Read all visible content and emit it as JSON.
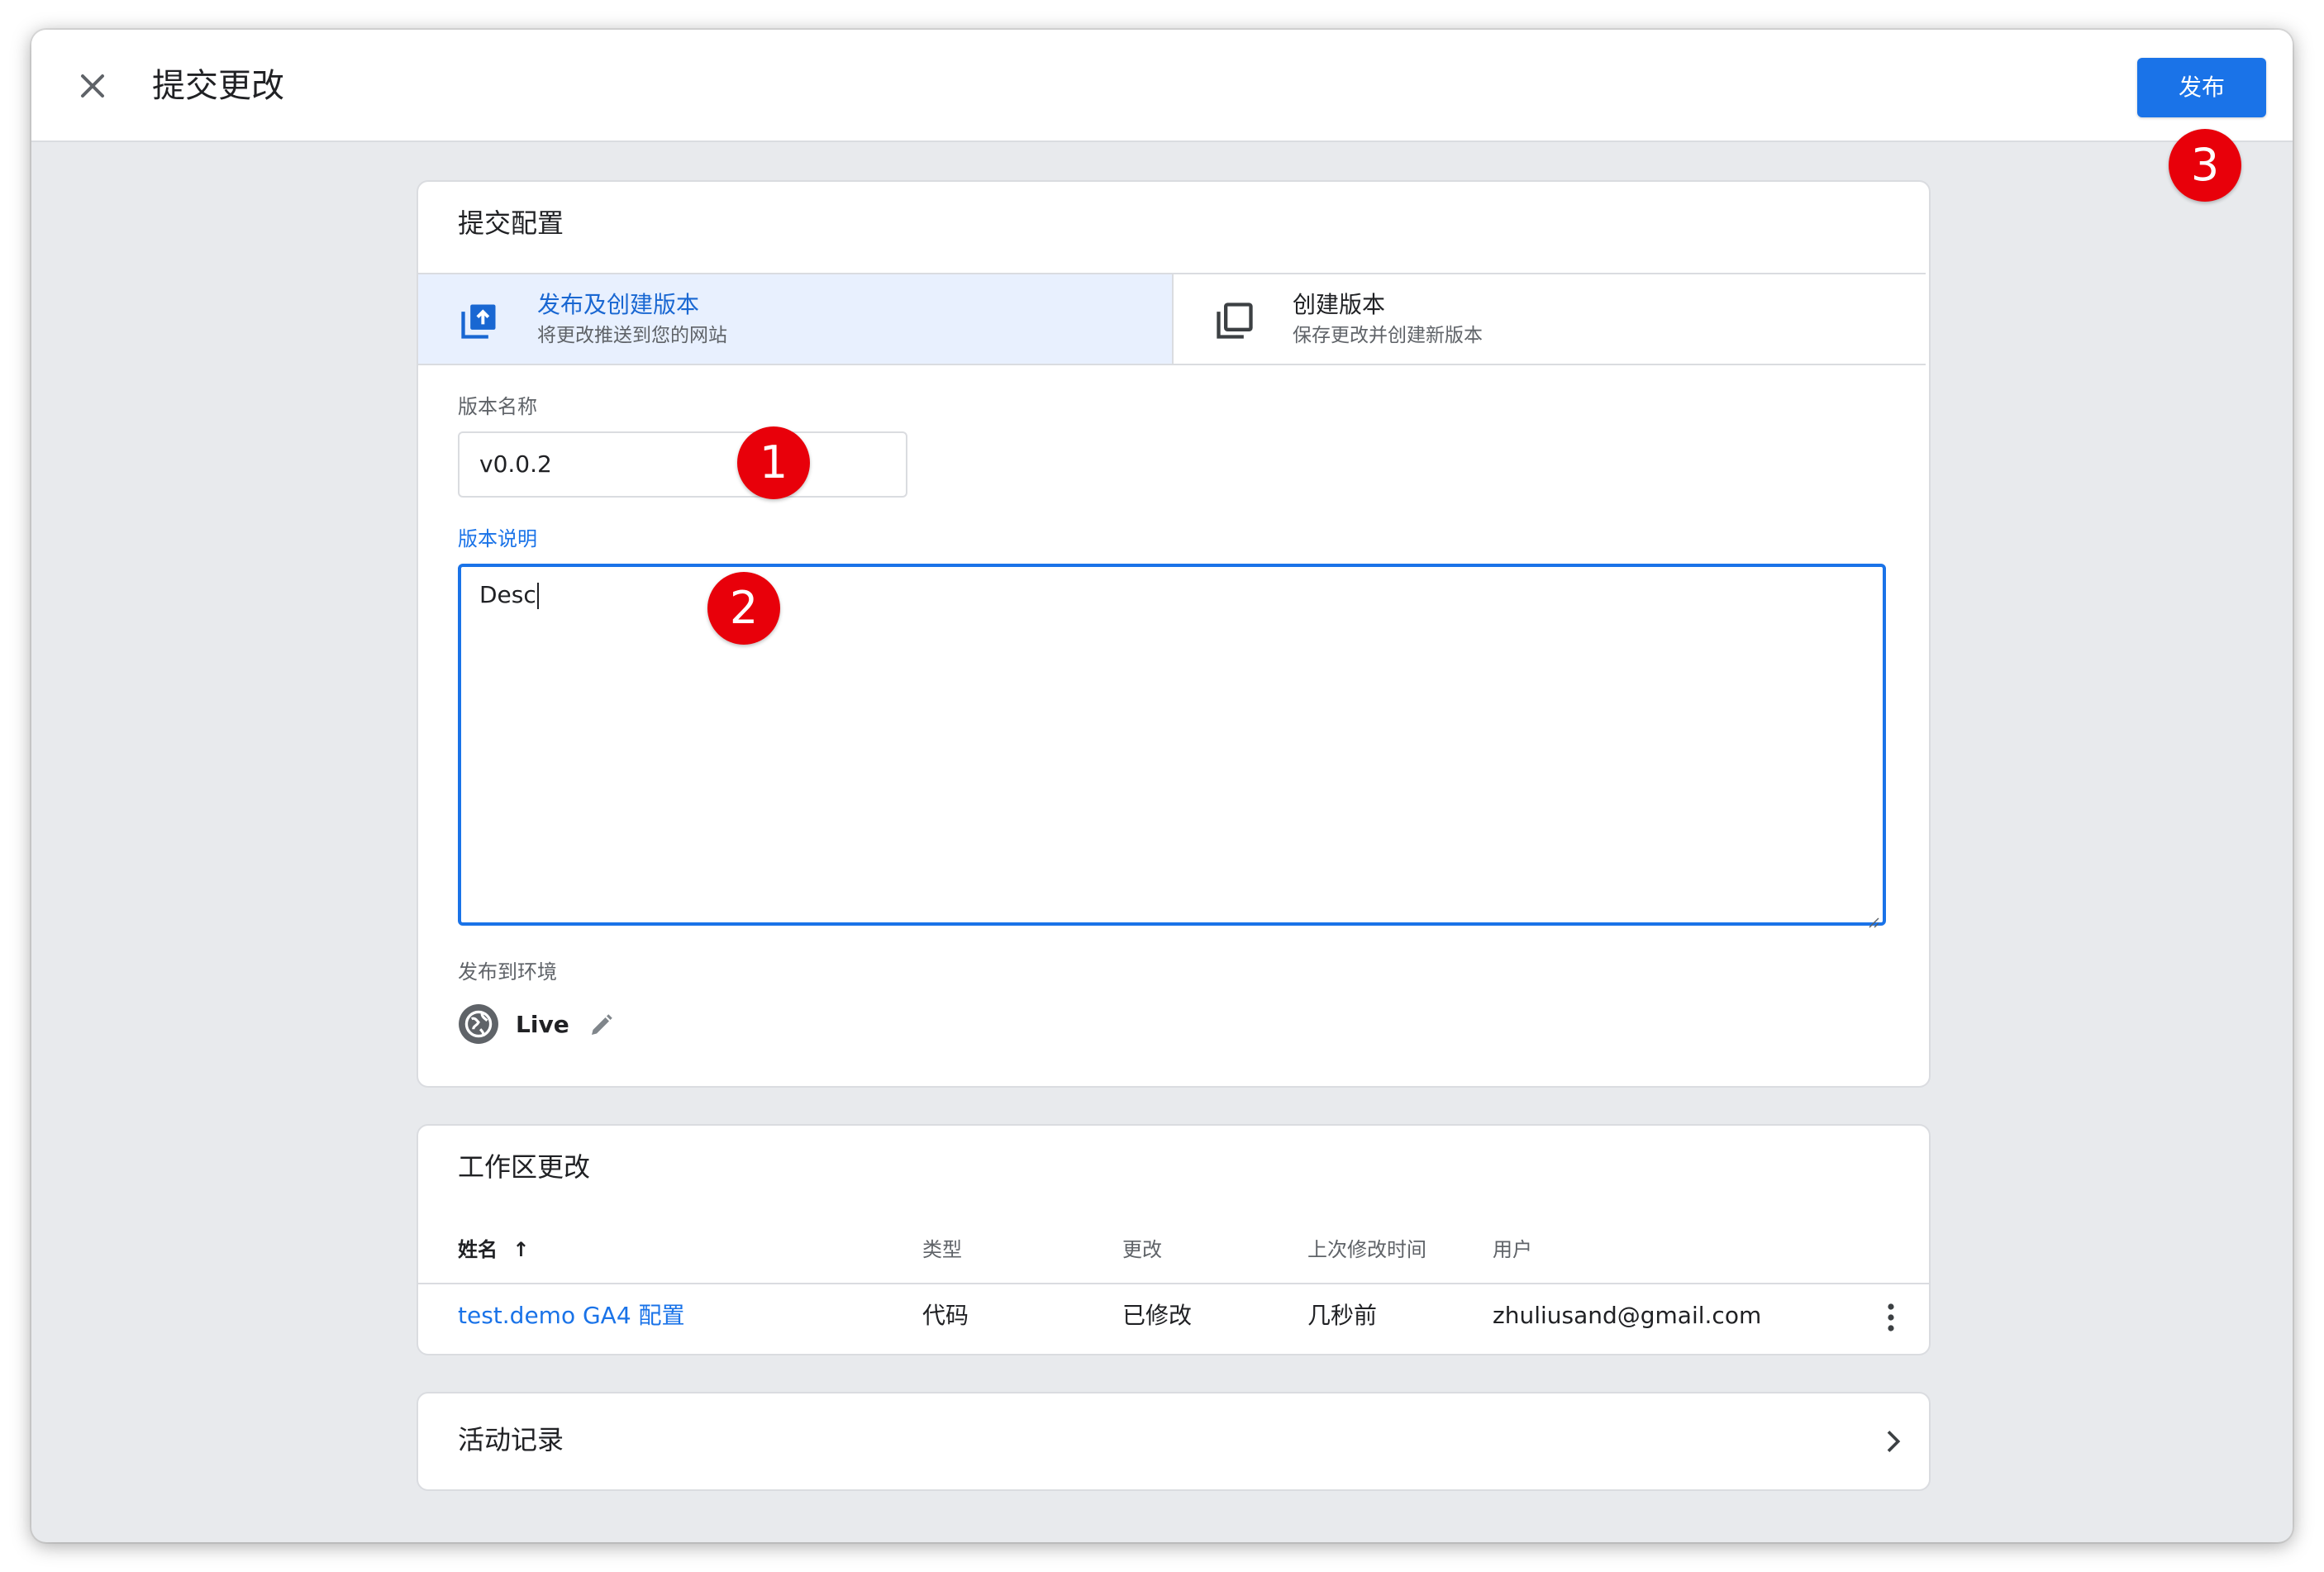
{
  "header": {
    "title": "提交更改",
    "publish_label": "发布"
  },
  "annotations": [
    "1",
    "2",
    "3"
  ],
  "submit_config": {
    "title": "提交配置",
    "tabs": [
      {
        "label": "发布及创建版本",
        "sublabel": "将更改推送到您的网站",
        "icon": "publish-upload-icon",
        "selected": true
      },
      {
        "label": "创建版本",
        "sublabel": "保存更改并创建新版本",
        "icon": "copy-version-icon",
        "selected": false
      }
    ],
    "version_name": {
      "label": "版本名称",
      "value": "v0.0.2"
    },
    "version_desc": {
      "label": "版本说明",
      "value": "Desc"
    },
    "environment": {
      "label": "发布到环境",
      "name": "Live",
      "icon": "globe-icon"
    }
  },
  "workspace_changes": {
    "title": "工作区更改",
    "columns": [
      "姓名",
      "类型",
      "更改",
      "上次修改时间",
      "用户"
    ],
    "sort_indicator": "↑",
    "rows": [
      {
        "name": "test.demo GA4 配置",
        "type": "代码",
        "change": "已修改",
        "modified": "几秒前",
        "user": "zhuliusand@gmail.com"
      }
    ]
  },
  "activity": {
    "title": "活动记录"
  },
  "colors": {
    "accent": "#1a73e8",
    "annotation": "#e8000a",
    "tab_selected_bg": "#e8f0fe"
  }
}
